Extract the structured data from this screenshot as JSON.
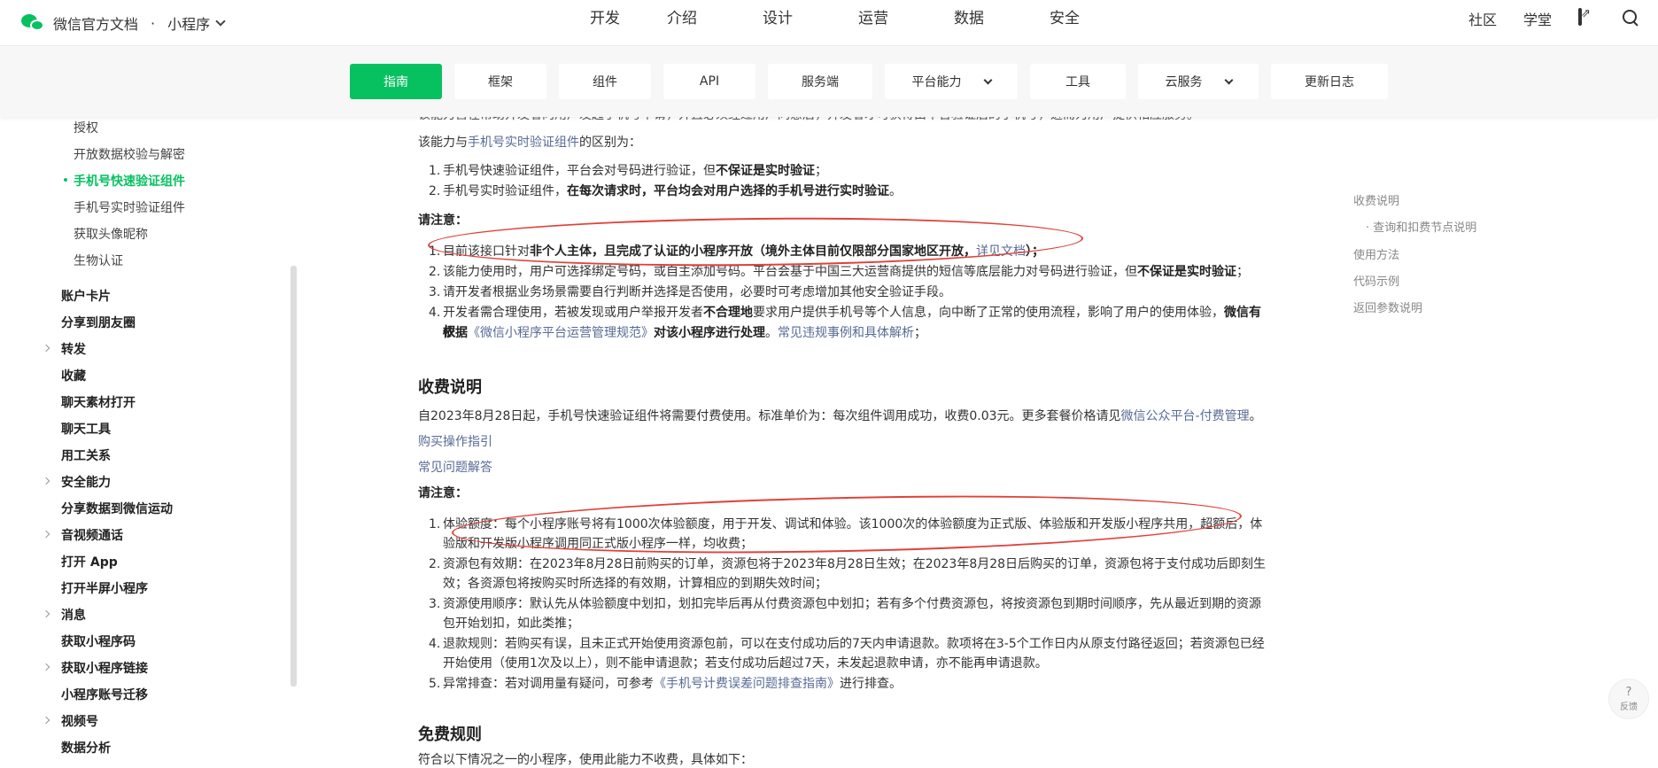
{
  "header": {
    "brand_title": "微信官方文档",
    "brand_dot": "·",
    "brand_sub": "小程序",
    "nav": [
      "开发",
      "介绍",
      "设计",
      "运营",
      "数据",
      "安全"
    ],
    "right": [
      "社区",
      "学堂"
    ]
  },
  "subtabs": [
    {
      "label": "指南",
      "active": true,
      "dropdown": false
    },
    {
      "label": "框架",
      "active": false,
      "dropdown": false
    },
    {
      "label": "组件",
      "active": false,
      "dropdown": false
    },
    {
      "label": "API",
      "active": false,
      "dropdown": false
    },
    {
      "label": "服务端",
      "active": false,
      "dropdown": false
    },
    {
      "label": "平台能力",
      "active": false,
      "dropdown": true
    },
    {
      "label": "工具",
      "active": false,
      "dropdown": false
    },
    {
      "label": "云服务",
      "active": false,
      "dropdown": true
    },
    {
      "label": "更新日志",
      "active": false,
      "dropdown": false
    }
  ],
  "sidebar": {
    "sub_items": [
      "授权",
      "开放数据校验与解密",
      "手机号快速验证组件",
      "手机号实时验证组件",
      "获取头像昵称",
      "生物认证"
    ],
    "top_items": [
      "账户卡片",
      "分享到朋友圈",
      "转发",
      "收藏",
      "聊天素材打开",
      "聊天工具",
      "用工关系",
      "安全能力",
      "分享数据到微信运动",
      "音视频通话",
      "打开 App",
      "打开半屏小程序",
      "消息",
      "获取小程序码",
      "获取小程序链接",
      "小程序账号迁移",
      "视频号",
      "数据分析"
    ]
  },
  "content": {
    "top_cut": "该能力旨在帮助开发者向用户发起手机号申请，并且必须经过用户同意后，开发者才可获得由平台验证后的手机号，进而为用户提供相应服务。",
    "diff_prefix": "该能力与",
    "diff_link": "手机号实时验证组件",
    "diff_suffix": "的区别为：",
    "diff_list": [
      {
        "a": "手机号快速验证组件，平台会对号码进行验证，但",
        "b": "不保证是实时验证",
        "c": "；"
      },
      {
        "a": "手机号实时验证组件，",
        "b": "在每次请求时，平台均会对用户选择的手机号进行实时验证",
        "c": "。"
      }
    ],
    "note_label": "请注意：",
    "note1": {
      "a": "目前该接口针对",
      "b": "非个人主体，且完成了认证的小程序开放（境外主体目前仅限部分国家地区开放，",
      "link": "详见文档",
      "c": "）；"
    },
    "note2": {
      "a": "该能力使用时，用户可选择绑定号码，或自主添加号码。平台会基于中国三大运营商提供的短信等底层能力对号码进行验证，但",
      "b": "不保证是实时验证",
      "c": "；"
    },
    "note3": "请开发者根据业务场景需要自行判断并选择是否使用，必要时可考虑增加其他安全验证手段。",
    "note4": {
      "a": "开发者需合理使用，若被发现或用户举报开发者",
      "b": "不合理地",
      "c": "要求用户提供手机号等个人信息，向中断了正常的使用流程，影响了用户的使用体验，",
      "d": "微信有权",
      "e": "依据",
      "link1": "《微信小程序平台运营管理规范》",
      "f": "对该小程序进行处理",
      "g": "。",
      "link2": "常见违规事例和具体解析",
      "h": "；"
    },
    "fee_title": "收费说明",
    "fee_intro_a": "自2023年8月28日起，手机号快速验证组件将需要付费使用。标准单价为：每次组件调用成功，收费0.03元。更多套餐价格请见",
    "fee_intro_link": "微信公众平台-付费管理",
    "fee_intro_b": "。",
    "buy_link": "购买操作指引",
    "faq_link": "常见问题解答",
    "note_label2": "请注意：",
    "fee_list": [
      {
        "l1": "体验额度：每个小程序账号将有1000次体验额度，用于开发、调试和体验。该1000次的体验额度为正式版、体验版和开发版小程序共用，超额后，体",
        "l2": "验版和开发版小程序调用同正式版小程序一样，均收费；"
      },
      {
        "l1": "资源包有效期：在2023年8月28日前购买的订单，资源包将于2023年8月28日生效；在2023年8月28日后购买的订单，资源包将于支付成功后即刻生",
        "l2": "效；各资源包将按购买时所选择的有效期，计算相应的到期失效时间；"
      },
      {
        "l1": "资源使用顺序：默认先从体验额度中划扣，划扣完毕后再从付费资源包中划扣；若有多个付费资源包，将按资源包到期时间顺序，先从最近到期的资源",
        "l2": "包开始划扣，如此类推；"
      },
      {
        "l1": "退款规则：若购买有误，且未正式开始使用资源包前，可以在支付成功后的7天内申请退款。款项将在3-5个工作日内从原支付路径返回；若资源包已经",
        "l2": "开始使用（使用1次及以上），则不能申请退款；若支付成功后超过7天，未发起退款申请，亦不能再申请退款。"
      }
    ],
    "fee5_a": "异常排查：若对调用量有疑问，可参考",
    "fee5_link": "《手机号计费误差问题排查指南》",
    "fee5_b": "进行排查。",
    "free_title": "免费规则",
    "free_intro": "符合以下情况之一的小程序，使用此能力不收费，具体如下："
  },
  "toc": [
    "收费说明",
    "· 查询和扣费节点说明",
    "使用方法",
    "代码示例",
    "返回参数说明"
  ],
  "feedback": {
    "q": "?",
    "label": "反馈"
  }
}
